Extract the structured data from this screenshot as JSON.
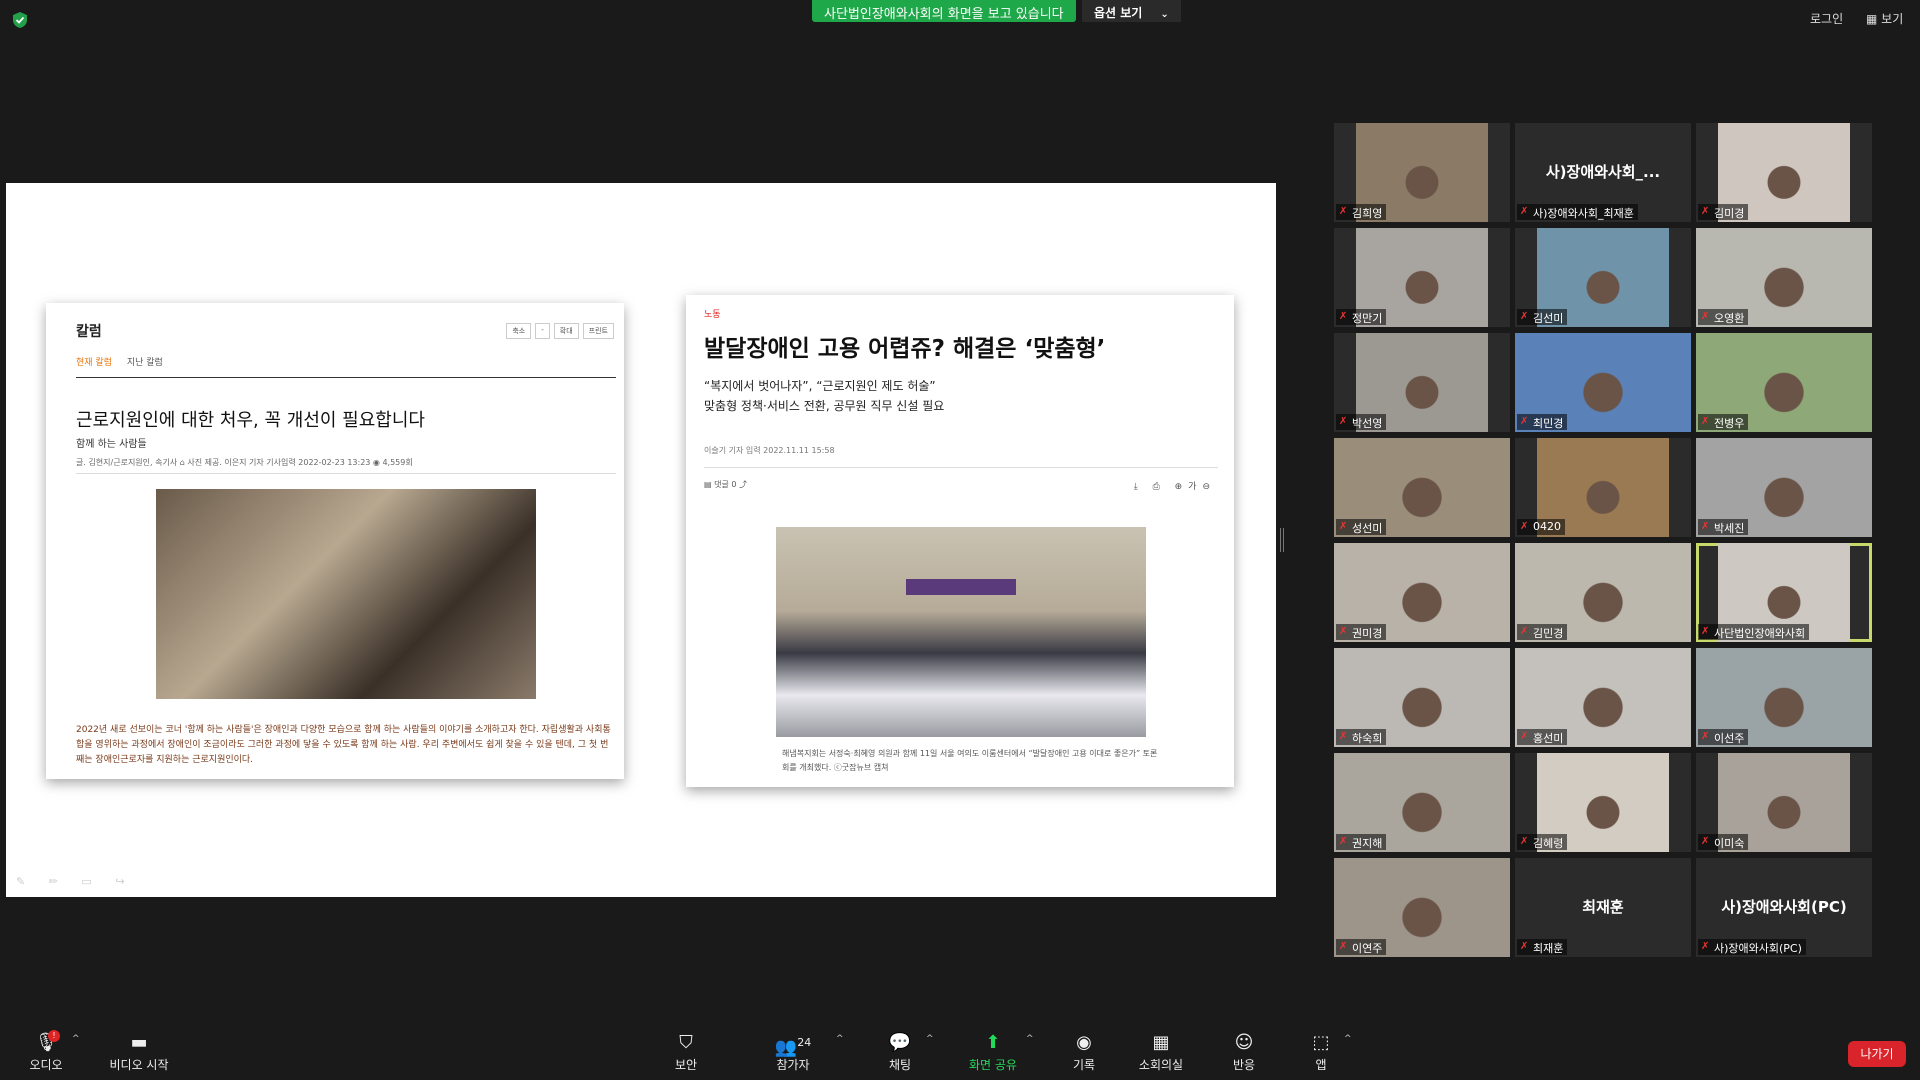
{
  "topbar": {
    "banner": "사단법인장애와사회의 화면을 보고 있습니다",
    "view_options": "옵션 보기",
    "login": "로그인",
    "view": "보기"
  },
  "left_article": {
    "header": "칼럼",
    "buttons": [
      "축소",
      "-",
      "확대",
      "프린트"
    ],
    "tab_current": "현재 칼럼",
    "tab_past": "지난 칼럼",
    "title": "근로지원인에 대한 처우, 꼭 개선이 필요합니다",
    "subtitle": "함께 하는 사람들",
    "meta": "글. 김현지/근로지원인, 속기사 ⌂ 사진 제공. 이은지 기자     기사입력  2022-02-23 13:23   ◉ 4,559회",
    "body": "2022년 새로 선보이는 코너 '함께 하는 사람들'은 장애인과 다양한 모습으로 함께 하는 사람들의 이야기를 소개하고자 한다. 자립생활과 사회통합을 영위하는 과정에서 장애인이 조금이라도 그러한 과정에 닿을 수 있도록 함께 하는 사람. 우리 주변에서도 쉽게 찾을 수 있을 텐데, 그 첫 번째는 장애인근로자를 지원하는 근로지원인이다."
  },
  "right_article": {
    "category": "노동",
    "title": "발달장애인 고용 어렵쥬? 해결은 ‘맞춤형’",
    "sub1": "“복지에서 벗어나자”, “근로지원인 제도 허술”",
    "sub2": "맞춤형 정책·서비스 전환, 공무원 직무 신설 필요",
    "meta": "이슬기 기자     입력 2022.11.11 15:58",
    "tools": "▤ 댓글 0    ⤴",
    "right_tools": "⤓ ⎙ ⊕가⊖",
    "caption": "해냄복지회는 서정숙·최혜영 의원과 함께 11일 서울 여의도 이룸센터에서 “발달장애인 고용 이대로 좋은가” 토론회를 개최했다. ⓒ굿잡뉴브 캡쳐"
  },
  "participants": [
    {
      "name": "김희영",
      "video": "#8a7a66"
    },
    {
      "name": "사)장애와사회_최재훈",
      "video": null,
      "big": "사)장애와사회_..."
    },
    {
      "name": "김미경",
      "video": "#cfc6bf"
    },
    {
      "name": "정만기",
      "video": "#a8a4a0"
    },
    {
      "name": "김선미",
      "video": "#6f93a8"
    },
    {
      "name": "오영환",
      "video": "#b9b8b0"
    },
    {
      "name": "박선영",
      "video": "#9c9892"
    },
    {
      "name": "최민경",
      "video": "#5a82b8"
    },
    {
      "name": "전병우",
      "video": "#8fa878"
    },
    {
      "name": "성선미",
      "video": "#9a8e7a"
    },
    {
      "name": "0420",
      "video": "#9a7a52"
    },
    {
      "name": "박세진",
      "video": "#a3a3a3"
    },
    {
      "name": "권미경",
      "video": "#b8b2a8"
    },
    {
      "name": "김민경",
      "video": "#bdb8ae"
    },
    {
      "name": "사단법인장애와사회",
      "video": "#cdc8c2",
      "active": true
    },
    {
      "name": "하숙희",
      "video": "#bcb8b4"
    },
    {
      "name": "홍선미",
      "video": "#c4c0bc"
    },
    {
      "name": "이선주",
      "video": "#9aa3a6"
    },
    {
      "name": "권지해",
      "video": "#aaa69e"
    },
    {
      "name": "김혜령",
      "video": "#d2ccc2"
    },
    {
      "name": "이미숙",
      "video": "#a8a29a"
    },
    {
      "name": "이연주",
      "video": "#9d948a"
    },
    {
      "name": "최재훈",
      "video": null,
      "big": "최재훈"
    },
    {
      "name": "사)장애와사회(PC)",
      "video": null,
      "big": "사)장애와사회(PC)"
    }
  ],
  "toolbar": {
    "audio": "오디오",
    "video": "비디오 시작",
    "security": "보안",
    "participants": "참가자",
    "participants_count": "24",
    "chat": "채팅",
    "share": "화면 공유",
    "record": "기록",
    "breakout": "소회의실",
    "reactions": "반응",
    "apps": "앱",
    "leave": "나가기",
    "audio_badge": "!"
  },
  "colors": {
    "banner_green": "#1fa84a",
    "leave_red": "#d8242a",
    "share_green": "#23d959",
    "active_speaker": "#c8d86a"
  }
}
